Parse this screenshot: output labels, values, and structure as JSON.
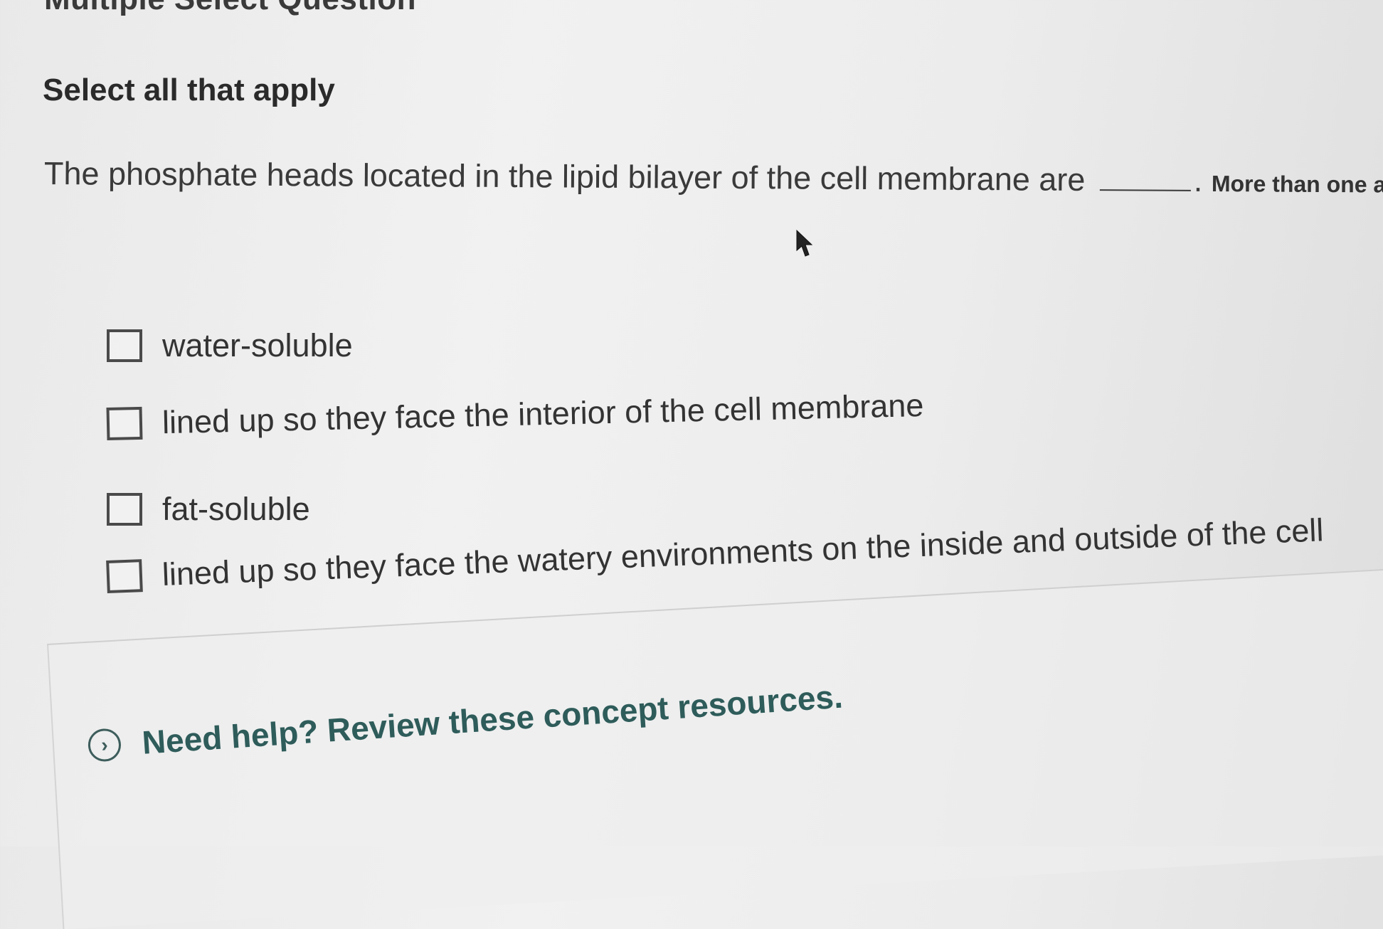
{
  "header": {
    "title": "Multiple Select Question"
  },
  "prompt": {
    "instruction": "Select all that apply",
    "question_text": "The phosphate heads located in the lipid bilayer of the cell membrane are",
    "after_blank": ".",
    "note": "More than one ans"
  },
  "options": [
    {
      "label": "water-soluble",
      "checked": false
    },
    {
      "label": "lined up so they face the interior of the cell membrane",
      "checked": false
    },
    {
      "label": "fat-soluble",
      "checked": false
    },
    {
      "label": "lined up so they face the watery environments on the inside and outside of the cell",
      "checked": false
    }
  ],
  "help": {
    "link_text": "Need help? Review these concept resources.",
    "icon": "chevron-right-circle-icon"
  },
  "colors": {
    "help_link": "#2e5c5a",
    "text": "#333333"
  }
}
